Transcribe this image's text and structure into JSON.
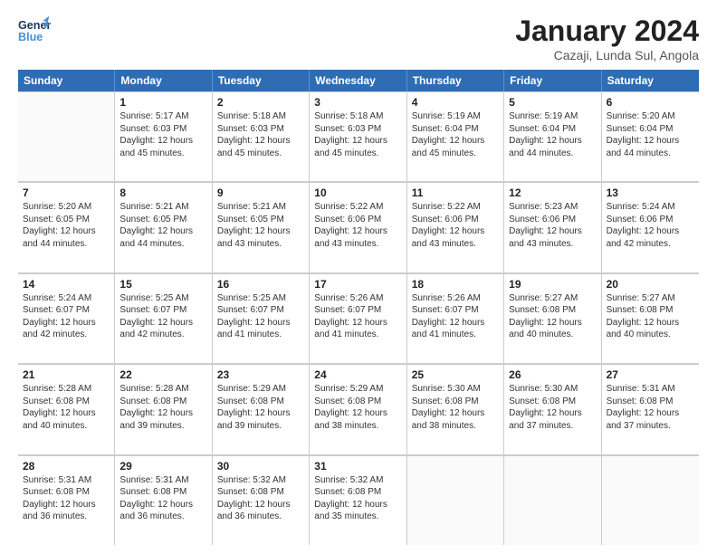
{
  "header": {
    "logo_line1": "General",
    "logo_line2": "Blue",
    "title": "January 2024",
    "subtitle": "Cazaji, Lunda Sul, Angola"
  },
  "days_of_week": [
    "Sunday",
    "Monday",
    "Tuesday",
    "Wednesday",
    "Thursday",
    "Friday",
    "Saturday"
  ],
  "weeks": [
    [
      {
        "day": "",
        "info": ""
      },
      {
        "day": "1",
        "info": "Sunrise: 5:17 AM\nSunset: 6:03 PM\nDaylight: 12 hours\nand 45 minutes."
      },
      {
        "day": "2",
        "info": "Sunrise: 5:18 AM\nSunset: 6:03 PM\nDaylight: 12 hours\nand 45 minutes."
      },
      {
        "day": "3",
        "info": "Sunrise: 5:18 AM\nSunset: 6:03 PM\nDaylight: 12 hours\nand 45 minutes."
      },
      {
        "day": "4",
        "info": "Sunrise: 5:19 AM\nSunset: 6:04 PM\nDaylight: 12 hours\nand 45 minutes."
      },
      {
        "day": "5",
        "info": "Sunrise: 5:19 AM\nSunset: 6:04 PM\nDaylight: 12 hours\nand 44 minutes."
      },
      {
        "day": "6",
        "info": "Sunrise: 5:20 AM\nSunset: 6:04 PM\nDaylight: 12 hours\nand 44 minutes."
      }
    ],
    [
      {
        "day": "7",
        "info": "Sunrise: 5:20 AM\nSunset: 6:05 PM\nDaylight: 12 hours\nand 44 minutes."
      },
      {
        "day": "8",
        "info": "Sunrise: 5:21 AM\nSunset: 6:05 PM\nDaylight: 12 hours\nand 44 minutes."
      },
      {
        "day": "9",
        "info": "Sunrise: 5:21 AM\nSunset: 6:05 PM\nDaylight: 12 hours\nand 43 minutes."
      },
      {
        "day": "10",
        "info": "Sunrise: 5:22 AM\nSunset: 6:06 PM\nDaylight: 12 hours\nand 43 minutes."
      },
      {
        "day": "11",
        "info": "Sunrise: 5:22 AM\nSunset: 6:06 PM\nDaylight: 12 hours\nand 43 minutes."
      },
      {
        "day": "12",
        "info": "Sunrise: 5:23 AM\nSunset: 6:06 PM\nDaylight: 12 hours\nand 43 minutes."
      },
      {
        "day": "13",
        "info": "Sunrise: 5:24 AM\nSunset: 6:06 PM\nDaylight: 12 hours\nand 42 minutes."
      }
    ],
    [
      {
        "day": "14",
        "info": "Sunrise: 5:24 AM\nSunset: 6:07 PM\nDaylight: 12 hours\nand 42 minutes."
      },
      {
        "day": "15",
        "info": "Sunrise: 5:25 AM\nSunset: 6:07 PM\nDaylight: 12 hours\nand 42 minutes."
      },
      {
        "day": "16",
        "info": "Sunrise: 5:25 AM\nSunset: 6:07 PM\nDaylight: 12 hours\nand 41 minutes."
      },
      {
        "day": "17",
        "info": "Sunrise: 5:26 AM\nSunset: 6:07 PM\nDaylight: 12 hours\nand 41 minutes."
      },
      {
        "day": "18",
        "info": "Sunrise: 5:26 AM\nSunset: 6:07 PM\nDaylight: 12 hours\nand 41 minutes."
      },
      {
        "day": "19",
        "info": "Sunrise: 5:27 AM\nSunset: 6:08 PM\nDaylight: 12 hours\nand 40 minutes."
      },
      {
        "day": "20",
        "info": "Sunrise: 5:27 AM\nSunset: 6:08 PM\nDaylight: 12 hours\nand 40 minutes."
      }
    ],
    [
      {
        "day": "21",
        "info": "Sunrise: 5:28 AM\nSunset: 6:08 PM\nDaylight: 12 hours\nand 40 minutes."
      },
      {
        "day": "22",
        "info": "Sunrise: 5:28 AM\nSunset: 6:08 PM\nDaylight: 12 hours\nand 39 minutes."
      },
      {
        "day": "23",
        "info": "Sunrise: 5:29 AM\nSunset: 6:08 PM\nDaylight: 12 hours\nand 39 minutes."
      },
      {
        "day": "24",
        "info": "Sunrise: 5:29 AM\nSunset: 6:08 PM\nDaylight: 12 hours\nand 38 minutes."
      },
      {
        "day": "25",
        "info": "Sunrise: 5:30 AM\nSunset: 6:08 PM\nDaylight: 12 hours\nand 38 minutes."
      },
      {
        "day": "26",
        "info": "Sunrise: 5:30 AM\nSunset: 6:08 PM\nDaylight: 12 hours\nand 37 minutes."
      },
      {
        "day": "27",
        "info": "Sunrise: 5:31 AM\nSunset: 6:08 PM\nDaylight: 12 hours\nand 37 minutes."
      }
    ],
    [
      {
        "day": "28",
        "info": "Sunrise: 5:31 AM\nSunset: 6:08 PM\nDaylight: 12 hours\nand 36 minutes."
      },
      {
        "day": "29",
        "info": "Sunrise: 5:31 AM\nSunset: 6:08 PM\nDaylight: 12 hours\nand 36 minutes."
      },
      {
        "day": "30",
        "info": "Sunrise: 5:32 AM\nSunset: 6:08 PM\nDaylight: 12 hours\nand 36 minutes."
      },
      {
        "day": "31",
        "info": "Sunrise: 5:32 AM\nSunset: 6:08 PM\nDaylight: 12 hours\nand 35 minutes."
      },
      {
        "day": "",
        "info": ""
      },
      {
        "day": "",
        "info": ""
      },
      {
        "day": "",
        "info": ""
      }
    ]
  ]
}
